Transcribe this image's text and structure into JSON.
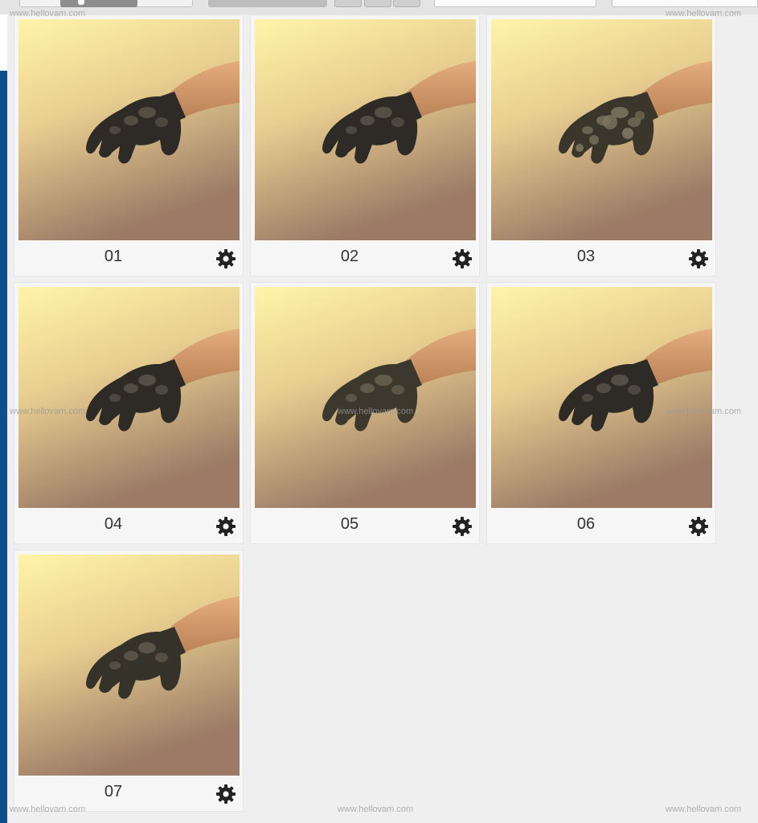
{
  "items": [
    {
      "label": "01",
      "icon": "gear-icon",
      "glove_color": "#2e2b26",
      "glove_highlight": "#5b554a",
      "camo": false
    },
    {
      "label": "02",
      "icon": "gear-icon",
      "glove_color": "#2e2b26",
      "glove_highlight": "#5b554a",
      "camo": false
    },
    {
      "label": "03",
      "icon": "gear-icon",
      "glove_color": "#3a362c",
      "glove_highlight": "#7e7560",
      "camo": true
    },
    {
      "label": "04",
      "icon": "gear-icon",
      "glove_color": "#2e2b26",
      "glove_highlight": "#5b554a",
      "camo": false
    },
    {
      "label": "05",
      "icon": "gear-icon",
      "glove_color": "#3d382d",
      "glove_highlight": "#6a6150",
      "camo": false
    },
    {
      "label": "06",
      "icon": "gear-icon",
      "glove_color": "#2e2b26",
      "glove_highlight": "#5b554a",
      "camo": false
    },
    {
      "label": "07",
      "icon": "gear-icon",
      "glove_color": "#35322a",
      "glove_highlight": "#625b4d",
      "camo": false
    }
  ],
  "watermark": "www.hellovam.com",
  "colors": {
    "accent_edge": "#0d4f8c",
    "background": "#efefef",
    "card": "#f6f6f6",
    "thumb_top": "#fff4a8",
    "thumb_bottom": "#9c7a66",
    "skin": "#d9a06e"
  }
}
